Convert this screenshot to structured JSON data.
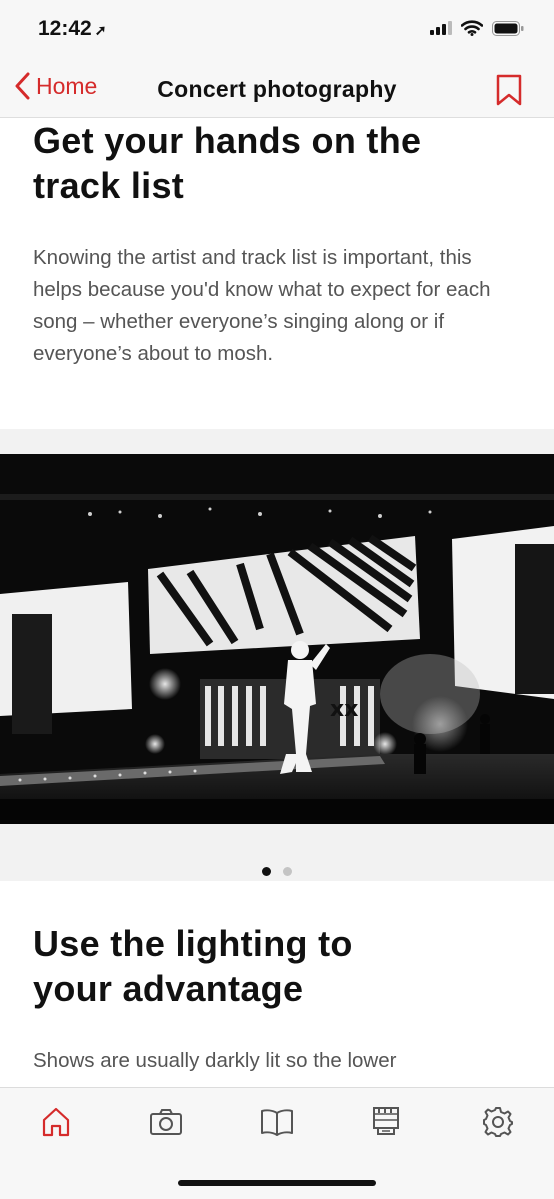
{
  "status": {
    "time": "12:42",
    "location_glyph": "➚"
  },
  "nav": {
    "back_label": "Home",
    "title": "Concert photography"
  },
  "sections": [
    {
      "heading_lines": [
        "Get your hands on the",
        "track list"
      ],
      "body": "Knowing the artist and track list is important, this helps because you'd know what to expect for each song – whether everyone’s singing along or if everyone’s about to mosh."
    },
    {
      "heading_lines": [
        "Use the lighting to",
        "your advantage"
      ],
      "body": "Shows are usually darkly lit so the lower"
    }
  ],
  "gallery": {
    "page_count": 2,
    "active_page": 1
  },
  "tabs": [
    {
      "name": "home-icon",
      "active": true
    },
    {
      "name": "camera-icon",
      "active": false
    },
    {
      "name": "book-icon",
      "active": false
    },
    {
      "name": "film-icon",
      "active": false
    },
    {
      "name": "gear-icon",
      "active": false
    }
  ],
  "colors": {
    "accent": "#d52b2b",
    "tab_icon": "#555555"
  }
}
